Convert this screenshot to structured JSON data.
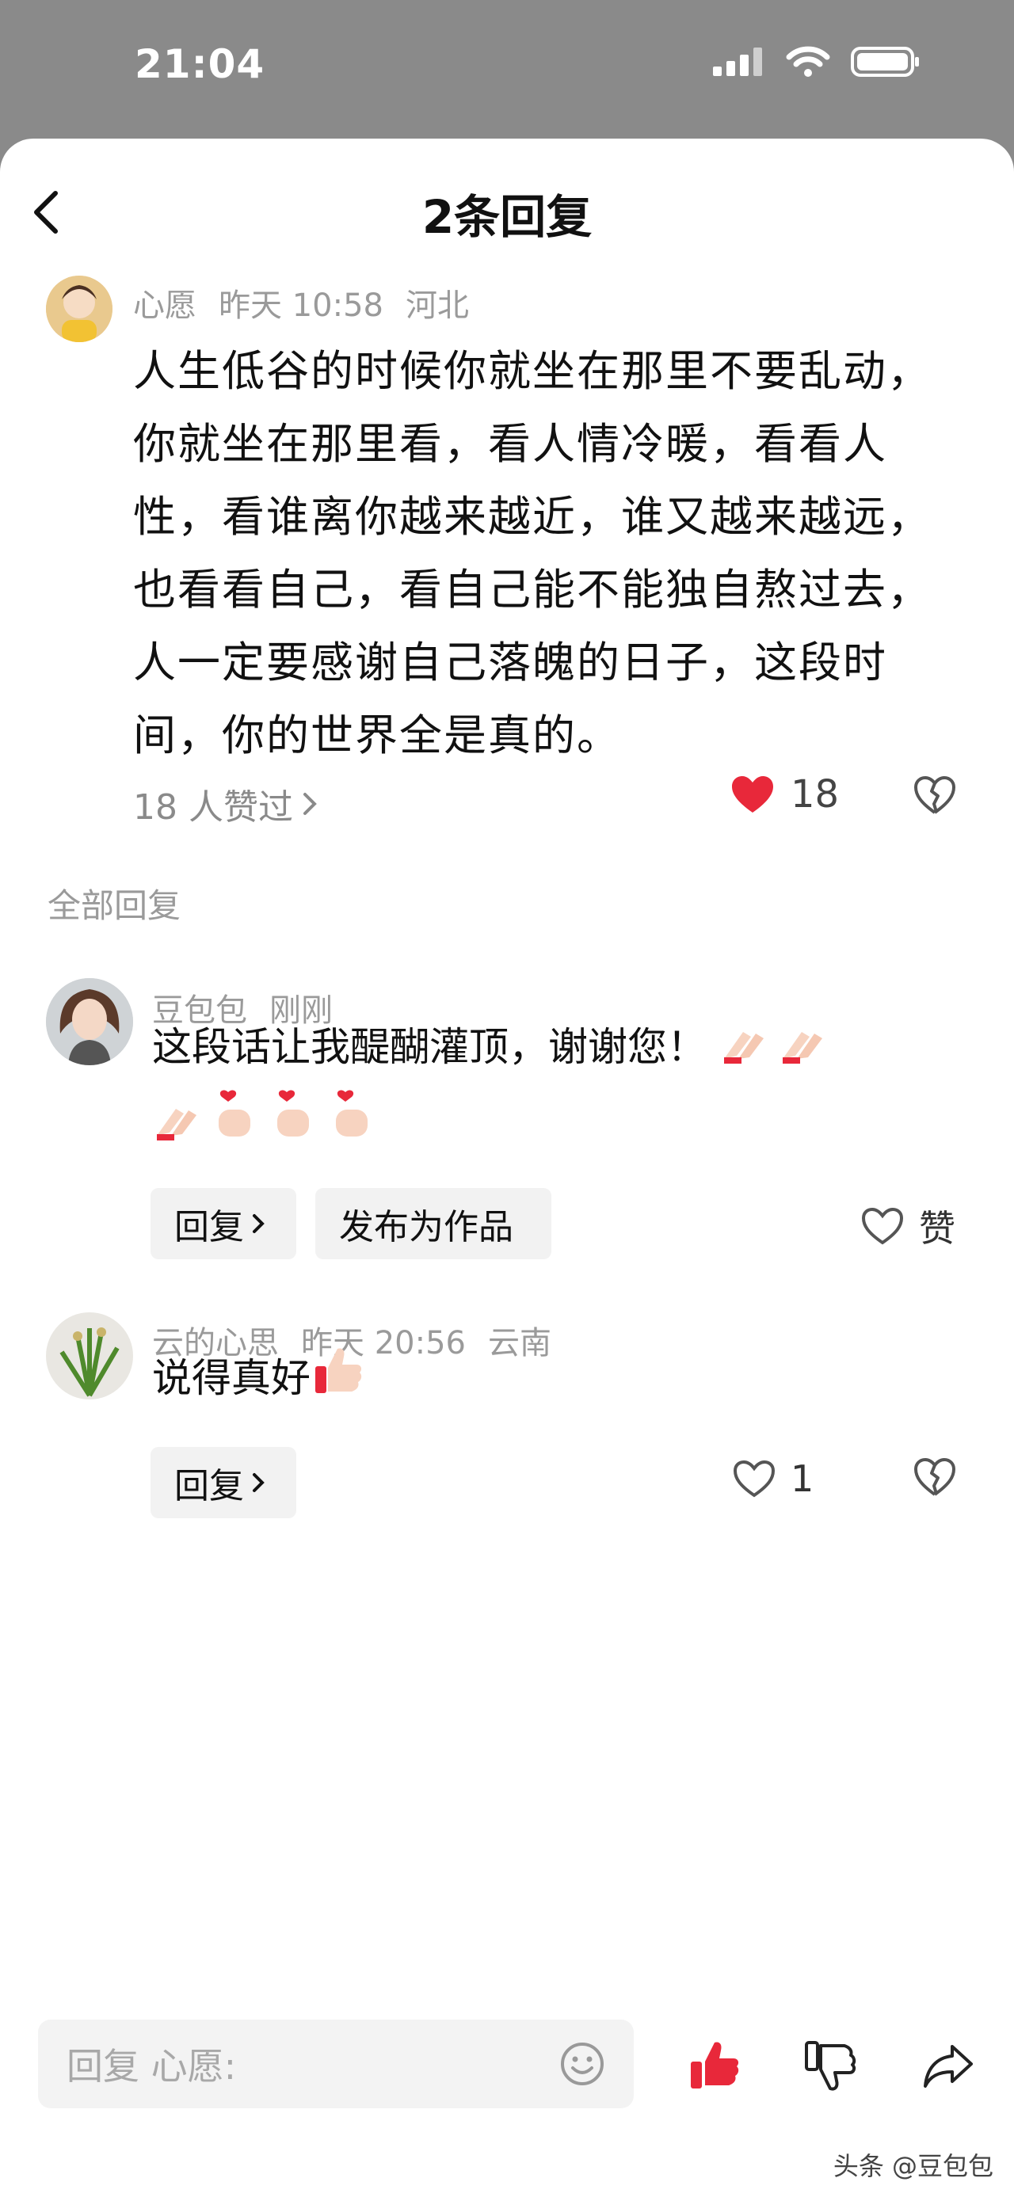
{
  "status": {
    "time": "21:04"
  },
  "header": {
    "title": "2条回复"
  },
  "main_comment": {
    "author": "心愿",
    "date": "昨天 10:58",
    "location": "河北",
    "text": "人生低谷的时候你就坐在那里不要乱动，你就坐在那里看，看人情冷暖，看看人性，看谁离你越来越近，谁又越来越远，也看看自己，看自己能不能独自熬过去，人一定要感谢自己落魄的日子，这段时间，你的世界全是真的。",
    "likes_label": "18 人赞过",
    "like_count": "18"
  },
  "section_label": "全部回复",
  "replies": [
    {
      "author": "豆包包",
      "time": "刚刚",
      "text": "这段话让我醍醐灌顶，谢谢您！",
      "reply_label": "回复",
      "publish_label": "发布为作品",
      "like_label": "赞"
    },
    {
      "author": "云的心思",
      "time": "昨天 20:56",
      "location": "云南",
      "text": "说得真好",
      "reply_label": "回复",
      "like_count": "1"
    }
  ],
  "bottom_bar": {
    "placeholder": "回复 心愿:"
  },
  "watermark": "头条 @豆包包",
  "colors": {
    "accent_red": "#e8283a",
    "chip_bg": "#f2f2f2",
    "meta_gray": "#9a9a9a"
  }
}
